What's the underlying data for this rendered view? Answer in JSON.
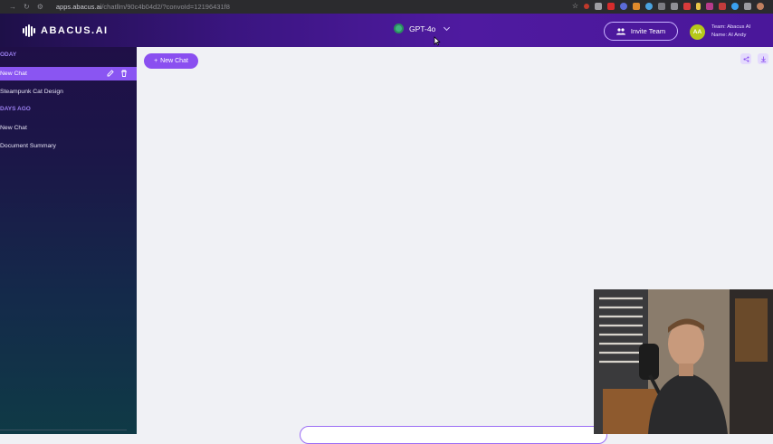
{
  "browser": {
    "url_host": "apps.abacus.ai",
    "url_path": "/chatllm/90c4b04d2/?convoId=12196431f8"
  },
  "header": {
    "logo_text": "ABACUS.AI",
    "model": "GPT-4o",
    "invite_label": "Invite Team",
    "avatar_initials": "AA",
    "team_line": "Team: Abacus AI",
    "name_line": "Name: AI Andy"
  },
  "sidebar": {
    "sections": [
      {
        "label": "ODAY",
        "items": [
          "New Chat",
          "Steampunk Cat Design"
        ]
      },
      {
        "label": "DAYS AGO",
        "items": [
          "New Chat",
          "Document Summary"
        ]
      }
    ]
  },
  "main": {
    "new_chat_label": "New Chat"
  },
  "colors": {
    "accent": "#8a4ff0",
    "header_dark": "#1e1048",
    "header_purple": "#4f1aa0",
    "sidebar_active": "#8a55f2",
    "model_dot": "#3fb27f"
  }
}
